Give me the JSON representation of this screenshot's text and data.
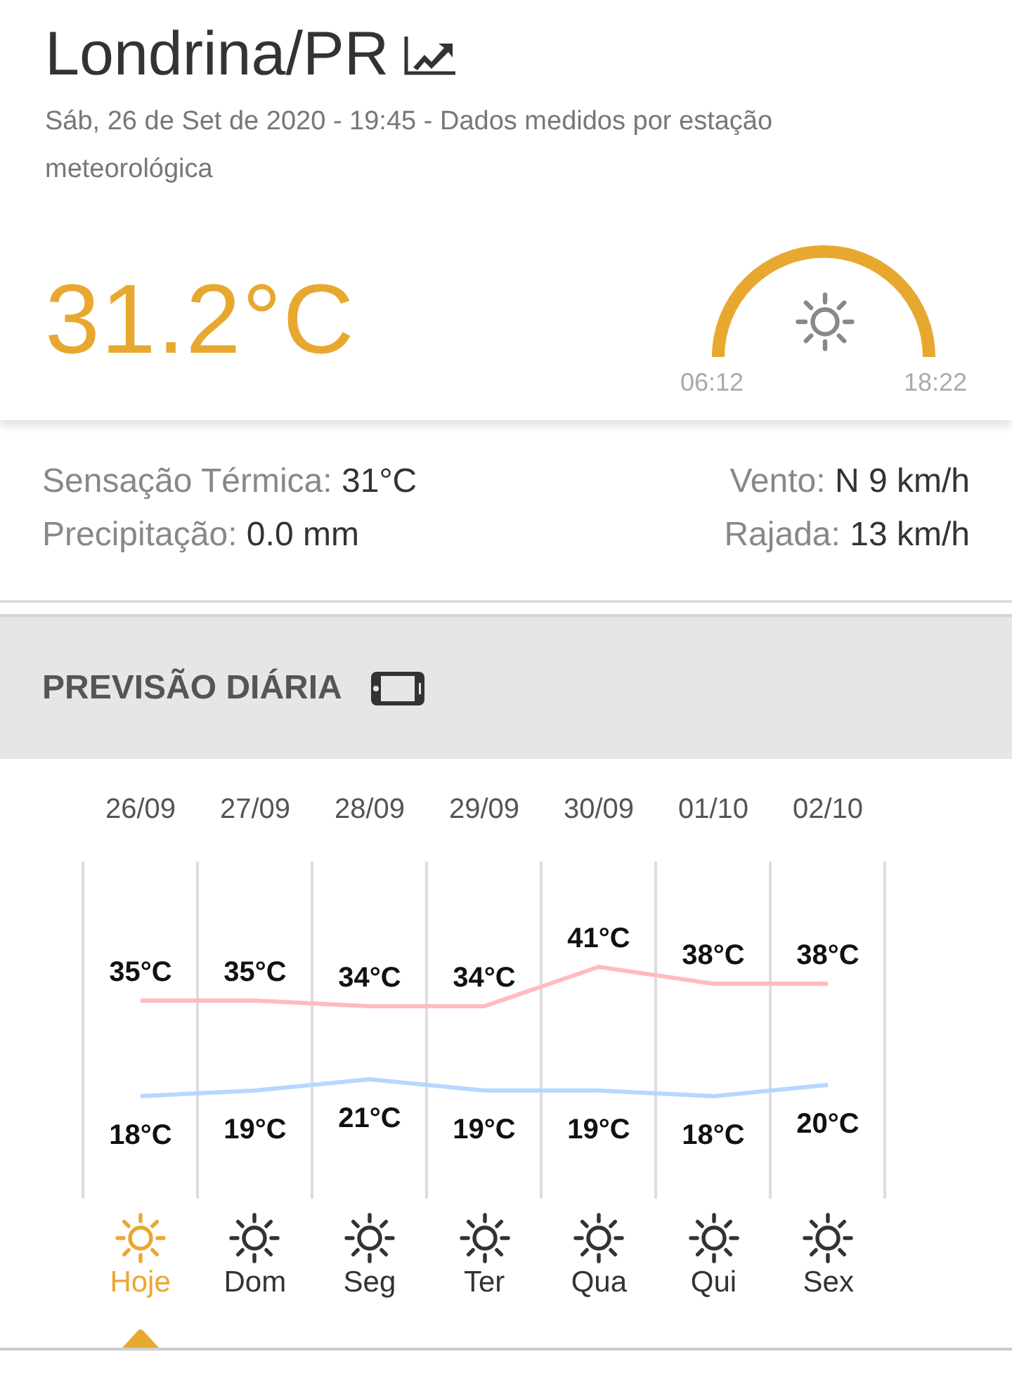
{
  "location": {
    "title": "Londrina/PR",
    "subtitle": "Sáb, 26 de Set de 2020 - 19:45 - Dados medidos por estação meteorológica"
  },
  "current": {
    "temperature": "31.2°C",
    "sunrise": "06:12",
    "sunset": "18:22"
  },
  "details": [
    {
      "label": "Sensação Térmica:",
      "value": "31°C"
    },
    {
      "label": "Vento:",
      "value": "N 9 km/h"
    },
    {
      "label": "Precipitação:",
      "value": "0.0 mm"
    },
    {
      "label": "Rajada:",
      "value": "13 km/h"
    }
  ],
  "forecast": {
    "title": "PREVISÃO DIÁRIA",
    "chart_data": {
      "type": "line",
      "categories": [
        "26/09",
        "27/09",
        "28/09",
        "29/09",
        "30/09",
        "01/10",
        "02/10"
      ],
      "series": [
        {
          "color": "#ffbcbc",
          "values": [
            35,
            35,
            34,
            34,
            41,
            38,
            38
          ],
          "value_labels": [
            "35°C",
            "35°C",
            "34°C",
            "34°C",
            "41°C",
            "38°C",
            "38°C"
          ]
        },
        {
          "color": "#b5d8ff",
          "values": [
            18,
            19,
            21,
            19,
            19,
            18,
            20
          ],
          "value_labels": [
            "18°C",
            "19°C",
            "21°C",
            "19°C",
            "19°C",
            "18°C",
            "20°C"
          ]
        }
      ]
    },
    "days": [
      {
        "label": "Hoje",
        "selected": true
      },
      {
        "label": "Dom",
        "selected": false
      },
      {
        "label": "Seg",
        "selected": false
      },
      {
        "label": "Ter",
        "selected": false
      },
      {
        "label": "Qua",
        "selected": false
      },
      {
        "label": "Qui",
        "selected": false
      },
      {
        "label": "Sex",
        "selected": false
      }
    ]
  }
}
